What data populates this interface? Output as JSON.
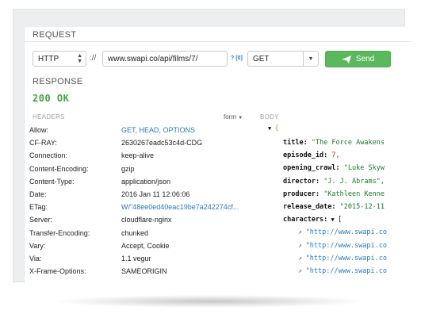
{
  "request": {
    "section_label": "REQUEST",
    "protocol": "HTTP",
    "separator": "://",
    "url": "www.swapi.co/api/films/7/",
    "help_link": "? [0]",
    "method": "GET",
    "send_label": "Send"
  },
  "response": {
    "section_label": "RESPONSE",
    "status": "200 OK",
    "headers_label": "HEADERS",
    "form_toggle": "form",
    "body_label": "BODY",
    "headers": [
      {
        "key": "Allow:",
        "value": "GET, HEAD, OPTIONS"
      },
      {
        "key": "CF-RAY:",
        "value": "2630267eadc53c4d-CDG"
      },
      {
        "key": "Connection:",
        "value": "keep-alive"
      },
      {
        "key": "Content-Encoding:",
        "value": "gzip"
      },
      {
        "key": "Content-Type:",
        "value": "application/json"
      },
      {
        "key": "Date:",
        "value": "2016 Jan 11 12:06:06"
      },
      {
        "key": "ETag:",
        "value": "W/\"48ee0ed40eac19be7a242274cf..."
      },
      {
        "key": "Server:",
        "value": "cloudflare-nginx"
      },
      {
        "key": "Transfer-Encoding:",
        "value": "chunked"
      },
      {
        "key": "Vary:",
        "value": "Accept, Cookie"
      },
      {
        "key": "Via:",
        "value": "1.1 vegur"
      },
      {
        "key": "X-Frame-Options:",
        "value": "SAMEORIGIN"
      }
    ],
    "body": {
      "open_brace": "{",
      "fields": [
        {
          "key": "title:",
          "value": "\"The Force Awakens",
          "type": "str"
        },
        {
          "key": "episode_id:",
          "value": "7,",
          "type": "num"
        },
        {
          "key": "opening_crawl:",
          "value": "\"Luke Skyw",
          "type": "str"
        },
        {
          "key": "director:",
          "value": "\"J. J. Abrams\",",
          "type": "str"
        },
        {
          "key": "producer:",
          "value": "\"Kathleen Kenne",
          "type": "str"
        },
        {
          "key": "release_date:",
          "value": "\"2015-12-11",
          "type": "str"
        }
      ],
      "characters_key": "characters:",
      "characters_open": "[",
      "character_urls": [
        "\"http://www.swapi.co",
        "\"http://www.swapi.co",
        "\"http://www.swapi.co",
        "\"http://www.swapi.co"
      ]
    }
  },
  "colors": {
    "send_button": "#5cb85c",
    "status_ok": "#3ea53e",
    "link": "#2a7ab8"
  }
}
